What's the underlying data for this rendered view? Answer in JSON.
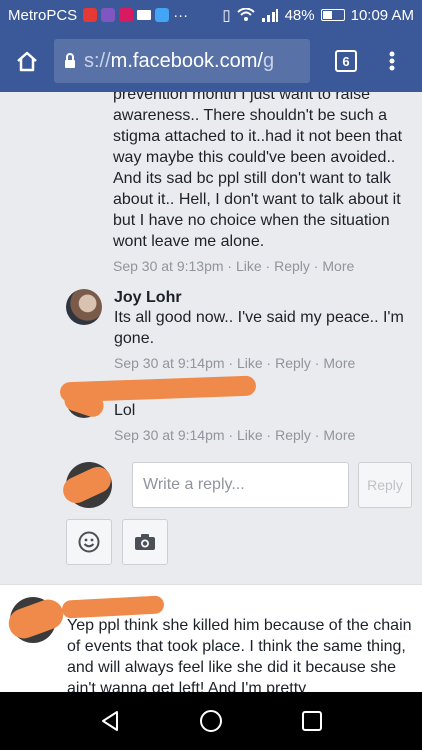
{
  "status_bar": {
    "carrier": "MetroPCS",
    "dots": "···",
    "battery": "48%",
    "battery_level": 0.48,
    "time": "10:09 AM"
  },
  "browser": {
    "url_scheme": "s://",
    "url_host": "m.facebook.com/",
    "url_rest": "g",
    "tab_count": "6"
  },
  "comments": [
    {
      "text": "prevention month I just want to raise awareness.. There shouldn't be such a stigma attached to it..had it not been that way maybe this could've been avoided.. And its sad bc ppl still don't want to talk about it.. Hell, I don't want to talk about it but I have no choice when the situation wont leave me alone.",
      "time": "Sep 30 at 9:13pm",
      "like": "Like",
      "reply": "Reply",
      "more": "More"
    },
    {
      "author": "Joy Lohr",
      "text": "Its all good now.. I've said my peace.. I'm gone.",
      "time": "Sep 30 at 9:14pm",
      "like": "Like",
      "reply": "Reply",
      "more": "More"
    },
    {
      "text": "Lol",
      "time": "Sep 30 at 9:14pm",
      "like": "Like",
      "reply": "Reply",
      "more": "More"
    },
    {
      "text": "Yep ppl think she killed him because of the chain of events that took place. I think the same thing, and will always feel like she did it because she ain't wanna get left! And I'm pretty"
    }
  ],
  "reply_box": {
    "placeholder": "Write a reply...",
    "button": "Reply"
  },
  "separator": " · "
}
